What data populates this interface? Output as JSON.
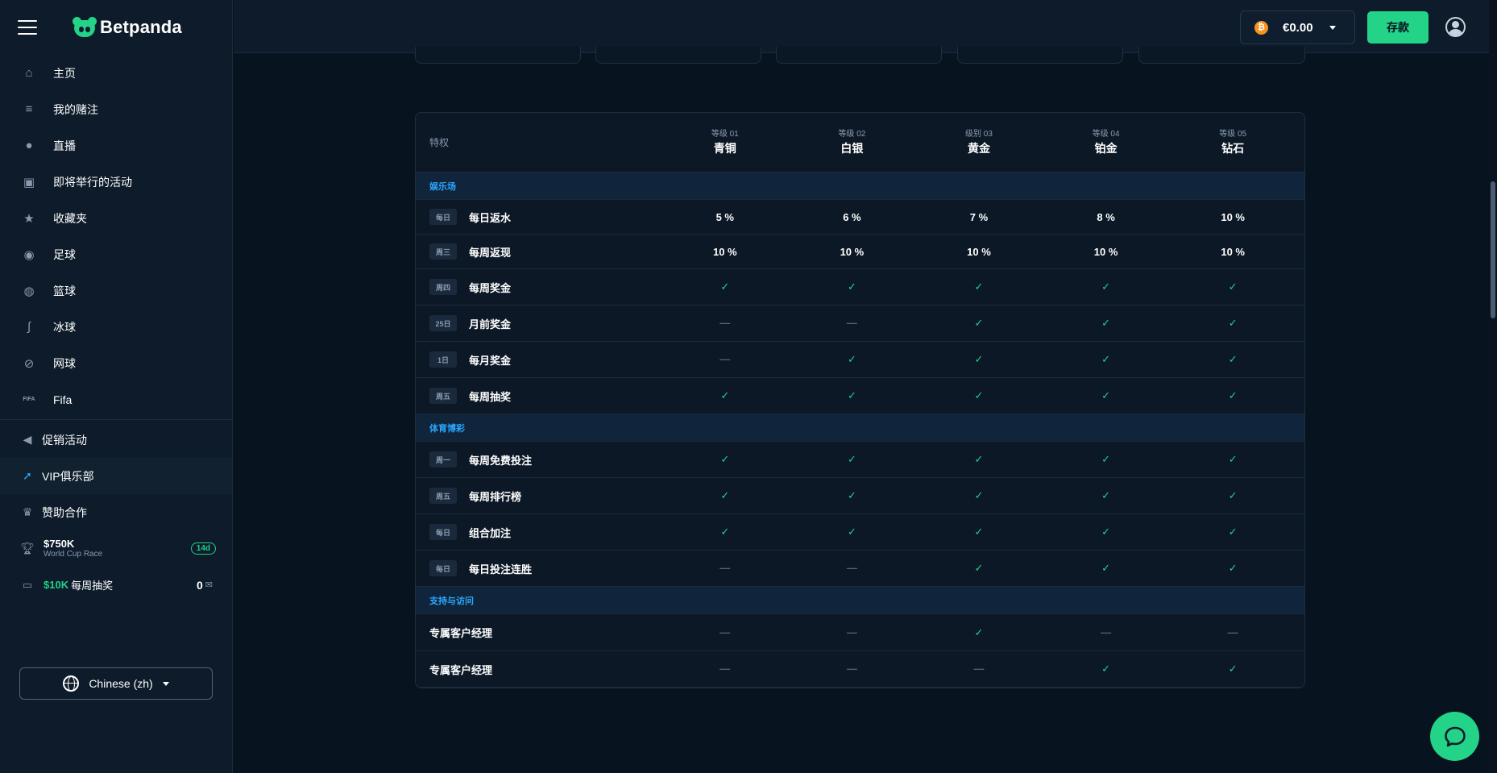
{
  "brand": {
    "name": "Betpanda",
    "accent": "#22d388"
  },
  "sidebar": {
    "items": [
      {
        "label": "主页",
        "icon": "home-icon"
      },
      {
        "label": "我的赌注",
        "icon": "coins-icon"
      },
      {
        "label": "直播",
        "icon": "microphone-icon"
      },
      {
        "label": "即将举行的活动",
        "icon": "calendar-icon"
      },
      {
        "label": "收藏夹",
        "icon": "star-icon"
      },
      {
        "label": "足球",
        "icon": "soccer-ball-icon"
      },
      {
        "label": "篮球",
        "icon": "basketball-icon"
      },
      {
        "label": "冰球",
        "icon": "hockey-stick-icon"
      },
      {
        "label": "网球",
        "icon": "tennis-racket-icon"
      },
      {
        "label": "Fifa",
        "icon": "fifa-icon"
      }
    ],
    "secondary": [
      {
        "label": "促销活动",
        "icon": "megaphone-icon"
      },
      {
        "label": "VIP俱乐部",
        "icon": "rocket-icon"
      },
      {
        "label": "赞助合作",
        "icon": "crown-icon"
      }
    ],
    "race": {
      "amount": "$750K",
      "name": "World Cup Race",
      "badge": "14d"
    },
    "lottery": {
      "amount": "$10K",
      "label": "每周抽奖",
      "count": "0"
    },
    "language": "Chinese (zh)"
  },
  "topbar": {
    "balance": "€0.00",
    "currency_symbol": "₿",
    "deposit_label": "存款"
  },
  "table": {
    "header_label": "特权",
    "levels": [
      {
        "num": "等级 01",
        "name": "青铜"
      },
      {
        "num": "等级 02",
        "name": "白银"
      },
      {
        "num": "级别 03",
        "name": "黄金"
      },
      {
        "num": "等级 04",
        "name": "铂金"
      },
      {
        "num": "等级 05",
        "name": "钻石"
      }
    ],
    "sections": [
      {
        "title": "娱乐场",
        "rows": [
          {
            "tag": "每日",
            "label": "每日返水",
            "values": [
              "5 %",
              "6 %",
              "7 %",
              "8 %",
              "10 %"
            ]
          },
          {
            "tag": "周三",
            "label": "每周返现",
            "values": [
              "10 %",
              "10 %",
              "10 %",
              "10 %",
              "10 %"
            ]
          },
          {
            "tag": "周四",
            "label": "每周奖金",
            "values": [
              "check",
              "check",
              "check",
              "check",
              "check"
            ]
          },
          {
            "tag": "25日",
            "label": "月前奖金",
            "values": [
              "dash",
              "dash",
              "check",
              "check",
              "check"
            ]
          },
          {
            "tag": "1日",
            "label": "每月奖金",
            "values": [
              "dash",
              "check",
              "check",
              "check",
              "check"
            ]
          },
          {
            "tag": "周五",
            "label": "每周抽奖",
            "values": [
              "check",
              "check",
              "check",
              "check",
              "check"
            ]
          }
        ]
      },
      {
        "title": "体育博彩",
        "rows": [
          {
            "tag": "周一",
            "label": "每周免费投注",
            "values": [
              "check",
              "check",
              "check",
              "check",
              "check"
            ]
          },
          {
            "tag": "周五",
            "label": "每周排行榜",
            "values": [
              "check",
              "check",
              "check",
              "check",
              "check"
            ]
          },
          {
            "tag": "每日",
            "label": "组合加注",
            "values": [
              "check",
              "check",
              "check",
              "check",
              "check"
            ]
          },
          {
            "tag": "每日",
            "label": "每日投注连胜",
            "values": [
              "dash",
              "dash",
              "check",
              "check",
              "check"
            ]
          }
        ]
      },
      {
        "title": "支持与访问",
        "rows": [
          {
            "tag": "",
            "label": "专属客户经理",
            "values": [
              "dash",
              "dash",
              "check",
              "dash",
              "dash"
            ]
          },
          {
            "tag": "",
            "label": "专属客户经理",
            "values": [
              "dash",
              "dash",
              "dash",
              "check",
              "check"
            ]
          }
        ]
      }
    ]
  },
  "symbols": {
    "check": "✓",
    "dash": "—"
  }
}
